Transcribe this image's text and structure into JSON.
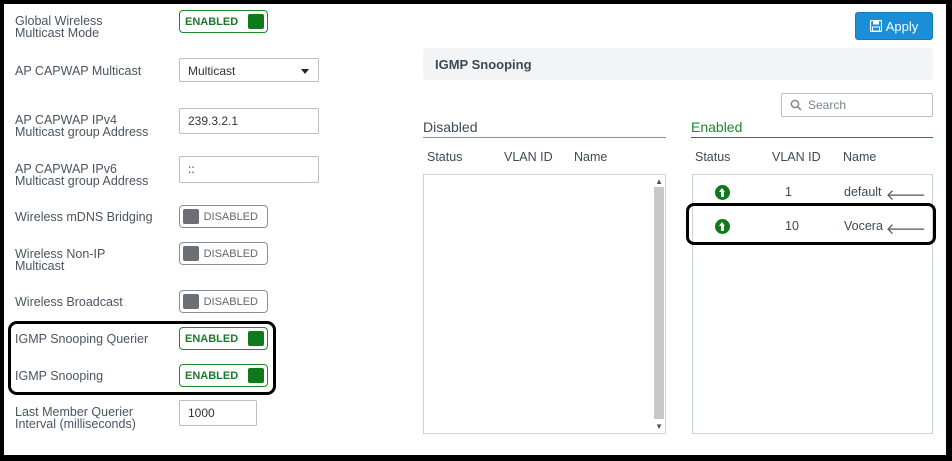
{
  "actions": {
    "apply_label": "Apply"
  },
  "settings": {
    "global_wireless_multicast_mode": {
      "label_line1": "Global Wireless",
      "label_line2": "Multicast Mode",
      "state": "ENABLED"
    },
    "ap_capwap_multicast": {
      "label": "AP CAPWAP Multicast",
      "value": "Multicast"
    },
    "ap_capwap_ipv4": {
      "label_line1": "AP CAPWAP IPv4",
      "label_line2": "Multicast group Address",
      "value": "239.3.2.1"
    },
    "ap_capwap_ipv6": {
      "label_line1": "AP CAPWAP IPv6",
      "label_line2": "Multicast group Address",
      "value": "::"
    },
    "wireless_mdns_bridging": {
      "label": "Wireless mDNS Bridging",
      "state": "DISABLED"
    },
    "wireless_non_ip_multicast": {
      "label_line1": "Wireless Non-IP",
      "label_line2": "Multicast",
      "state": "DISABLED"
    },
    "wireless_broadcast": {
      "label": "Wireless Broadcast",
      "state": "DISABLED"
    },
    "igmp_snooping_querier": {
      "label": "IGMP Snooping Querier",
      "state": "ENABLED"
    },
    "igmp_snooping": {
      "label": "IGMP Snooping",
      "state": "ENABLED"
    },
    "last_member_querier_interval": {
      "label_line1": "Last Member Querier",
      "label_line2": "Interval (milliseconds)",
      "value": "1000"
    }
  },
  "igmp_section": {
    "title": "IGMP Snooping",
    "search_placeholder": "Search",
    "disabled_title": "Disabled",
    "enabled_title": "Enabled",
    "columns": {
      "status": "Status",
      "vlan_id": "VLAN ID",
      "name": "Name"
    },
    "enabled_rows": [
      {
        "vlan_id": "1",
        "name": "default"
      },
      {
        "vlan_id": "10",
        "name": "Vocera"
      }
    ]
  },
  "colors": {
    "enabled_green": "#0f7a1c",
    "apply_blue": "#1a8fd8",
    "disabled_gray": "#6b6e72"
  },
  "icons": {
    "apply": "save-icon",
    "search": "search-icon",
    "status": "arrow-up-circle-icon",
    "move": "arrow-left-icon"
  }
}
